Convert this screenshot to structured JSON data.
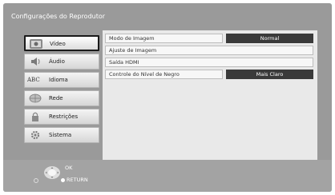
{
  "window": {
    "title": "Configurações do Reprodutor"
  },
  "sidebar": {
    "items": [
      {
        "label": "Vídeo",
        "icon": "video-icon",
        "selected": true
      },
      {
        "label": "Áudio",
        "icon": "audio-icon",
        "selected": false
      },
      {
        "label": "Idioma",
        "icon": "language-icon",
        "abc": "ABC",
        "selected": false
      },
      {
        "label": "Rede",
        "icon": "network-icon",
        "selected": false
      },
      {
        "label": "Restrições",
        "icon": "lock-icon",
        "selected": false
      },
      {
        "label": "Sistema",
        "icon": "system-icon",
        "selected": false
      }
    ]
  },
  "settings": {
    "rows": [
      {
        "label": "Modo de Imagem",
        "value": "Normal"
      },
      {
        "label": "Ajuste de Imagem"
      },
      {
        "label": "Saída HDMI"
      },
      {
        "label": "Controle do Nível de Negro",
        "value": "Mais Claro"
      }
    ]
  },
  "footer": {
    "ok_label": "OK",
    "return_label": "RETURN"
  },
  "colors": {
    "background": "#9a9a9a",
    "value_bg": "#3a3a3a",
    "selected_border": "#1a1a1a"
  }
}
